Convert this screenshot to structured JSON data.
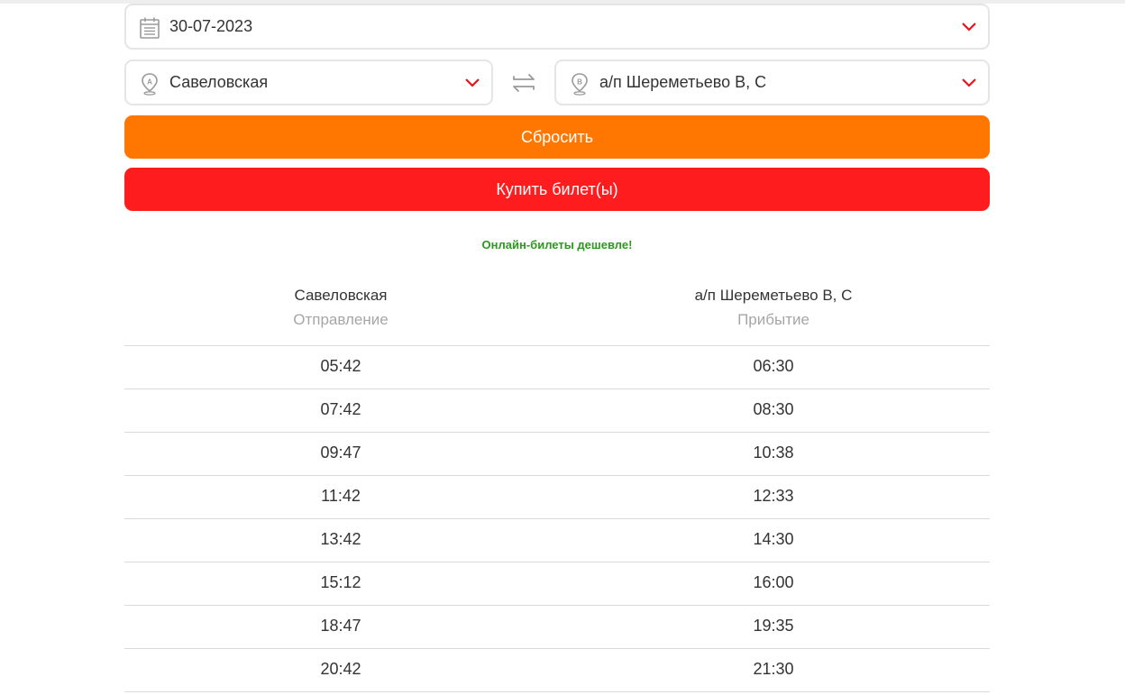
{
  "form": {
    "date": "30-07-2023",
    "from": "Савеловская",
    "to": "а/п Шереметьево B, C"
  },
  "buttons": {
    "reset": "Сбросить",
    "buy": "Купить билет(ы)"
  },
  "promo_text": "Онлайн-билеты дешевле!",
  "schedule": {
    "headers": [
      {
        "station": "Савеловская",
        "label": "Отправление"
      },
      {
        "station": "а/п Шереметьево B, C",
        "label": "Прибытие"
      }
    ],
    "rows": [
      [
        "05:42",
        "06:30"
      ],
      [
        "07:42",
        "08:30"
      ],
      [
        "09:47",
        "10:38"
      ],
      [
        "11:42",
        "12:33"
      ],
      [
        "13:42",
        "14:30"
      ],
      [
        "15:12",
        "16:00"
      ],
      [
        "18:47",
        "19:35"
      ],
      [
        "20:42",
        "21:30"
      ]
    ]
  },
  "icons": {
    "date": "calendar-icon",
    "from": "location-pin-a-icon",
    "to": "location-pin-b-icon",
    "dropdown": "chevron-down-icon",
    "swap": "swap-arrows-icon"
  },
  "colors": {
    "reset_button": "#ff7700",
    "buy_button": "#ff1c1f",
    "promo_text": "#2a9a1a",
    "chevron": "#e8141a"
  }
}
